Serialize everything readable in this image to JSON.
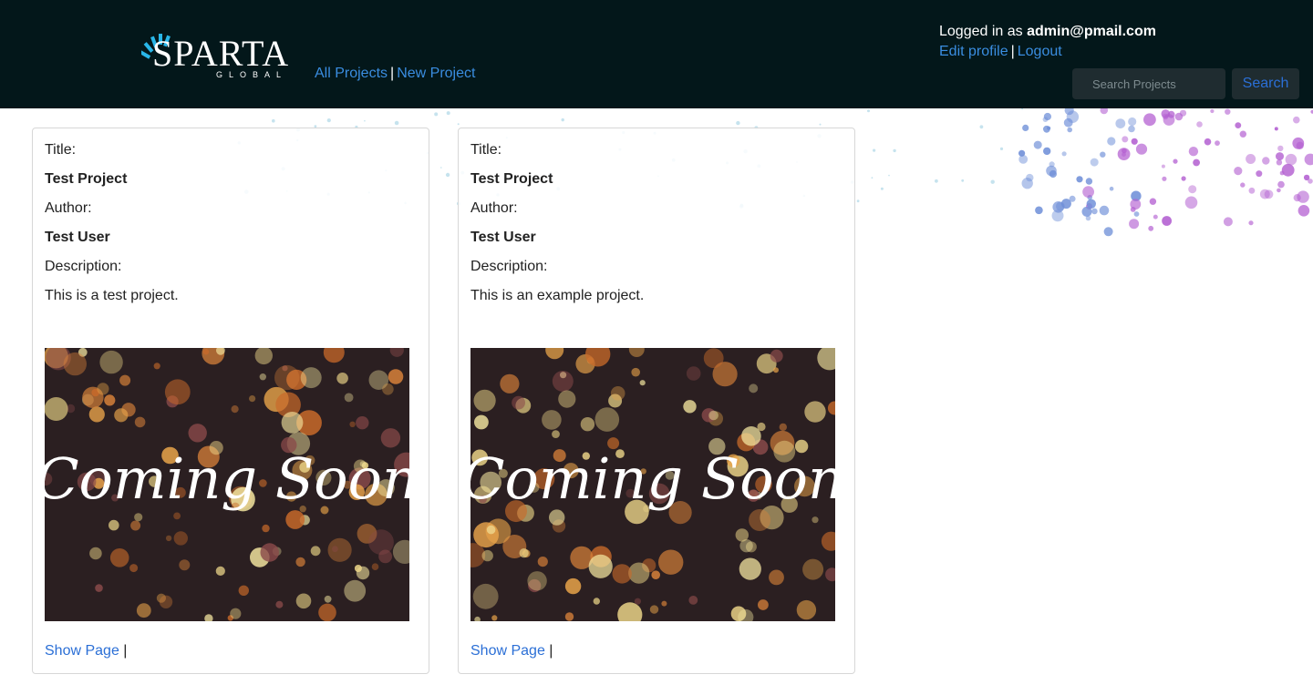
{
  "header": {
    "logo": {
      "word": "SPARTA",
      "sub": "GLOBAL"
    },
    "nav": {
      "all_projects": "All Projects",
      "new_project": "New Project",
      "separator": "|"
    },
    "user": {
      "prefix": "Logged in as",
      "email": "admin@pmail.com",
      "edit_profile": "Edit profile",
      "logout": "Logout",
      "separator": "|"
    },
    "search": {
      "placeholder": "Search Projects",
      "button": "Search"
    }
  },
  "cards": [
    {
      "title_label": "Title:",
      "title": "Test Project",
      "author_label": "Author:",
      "author": "Test User",
      "description_label": "Description:",
      "description": "This is a test project.",
      "image_text": "Coming Soon",
      "show_link": "Show Page",
      "separator": "|"
    },
    {
      "title_label": "Title:",
      "title": "Test Project",
      "author_label": "Author:",
      "author": "Test User",
      "description_label": "Description:",
      "description": "This is an example project.",
      "image_text": "Coming Soon",
      "show_link": "Show Page",
      "separator": "|"
    }
  ],
  "colors": {
    "navbar": "#03171a",
    "link": "#3a8de0",
    "card_link": "#2b6fd6"
  }
}
